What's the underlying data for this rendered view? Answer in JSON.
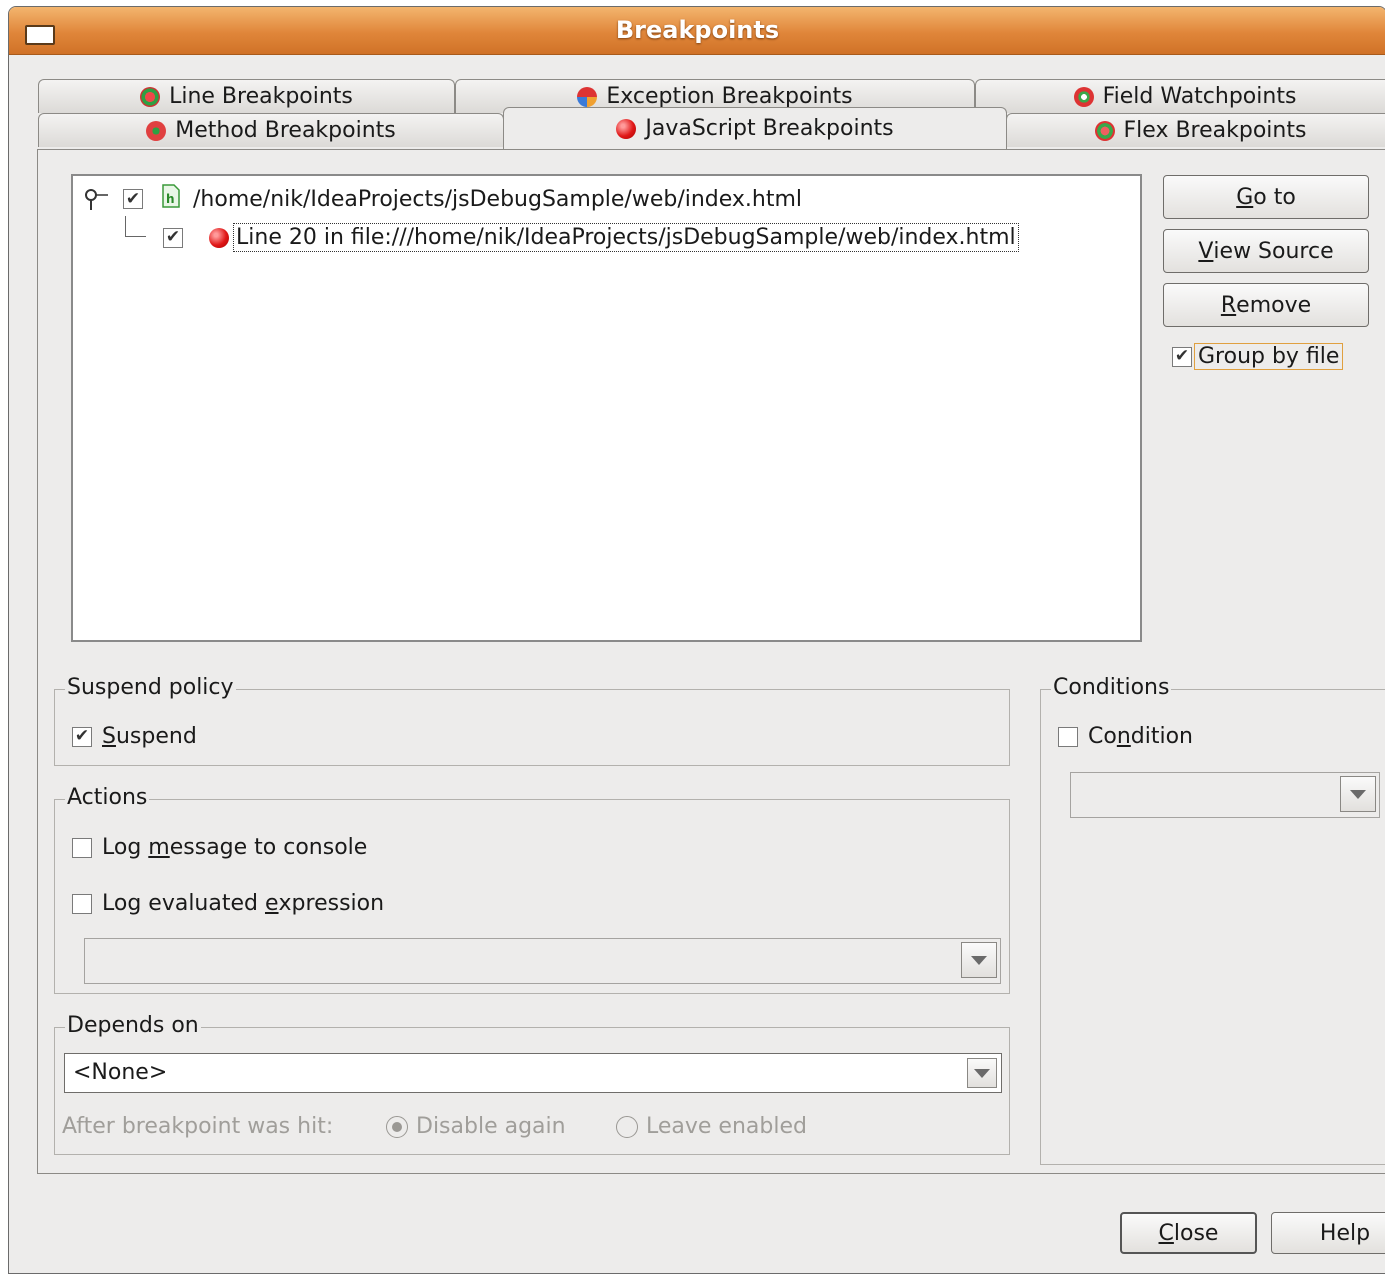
{
  "window": {
    "title": "Breakpoints"
  },
  "tabs": {
    "row1": [
      {
        "label": "Line Breakpoints",
        "icon": "line-breakpoint-icon"
      },
      {
        "label": "Exception Breakpoints",
        "icon": "exception-breakpoint-icon"
      },
      {
        "label": "Field Watchpoints",
        "icon": "field-watchpoint-icon"
      }
    ],
    "row2": [
      {
        "label": "Method Breakpoints",
        "icon": "method-breakpoint-icon"
      },
      {
        "label": "JavaScript Breakpoints",
        "icon": "javascript-breakpoint-icon",
        "selected": true
      },
      {
        "label": "Flex Breakpoints",
        "icon": "flex-breakpoint-icon"
      }
    ]
  },
  "tree": {
    "file_node": {
      "label": "/home/nik/IdeaProjects/jsDebugSample/web/index.html",
      "checked": true,
      "icon": "html-file-icon"
    },
    "breakpoint_node": {
      "label": "Line 20 in file:///home/nik/IdeaProjects/jsDebugSample/web/index.html",
      "checked": true,
      "icon": "breakpoint-icon"
    }
  },
  "side_buttons": {
    "goto": {
      "pre": "",
      "key": "G",
      "post": "o to"
    },
    "view_source": {
      "pre": "",
      "key": "V",
      "post": "iew Source"
    },
    "remove": {
      "pre": "",
      "key": "R",
      "post": "emove"
    },
    "group_by_file": {
      "label": "Group by file",
      "checked": true
    }
  },
  "suspend_policy": {
    "legend": "Suspend policy",
    "suspend": {
      "key": "S",
      "post": "uspend",
      "checked": true
    }
  },
  "actions": {
    "legend": "Actions",
    "log_message": {
      "pre": "Log ",
      "key": "m",
      "post": "essage to console",
      "checked": false
    },
    "log_expression": {
      "pre": "Log evaluated ",
      "key": "e",
      "post": "xpression",
      "checked": false
    },
    "expression_value": ""
  },
  "depends_on": {
    "legend": "Depends on",
    "selected": "<None>",
    "after_hit_label": "After breakpoint was hit:",
    "disable_again": "Disable again",
    "leave_enabled": "Leave enabled",
    "selected_option": "Disable again"
  },
  "conditions": {
    "legend": "Conditions",
    "condition": {
      "pre": "Co",
      "key": "n",
      "post": "dition",
      "checked": false
    },
    "condition_value": ""
  },
  "footer": {
    "close": {
      "key": "C",
      "post": "lose"
    },
    "help": "Help"
  },
  "colors": {
    "titlebar": "#e0863a",
    "dialog_bg": "#edeceb",
    "focus_outline": "#e0a040"
  }
}
